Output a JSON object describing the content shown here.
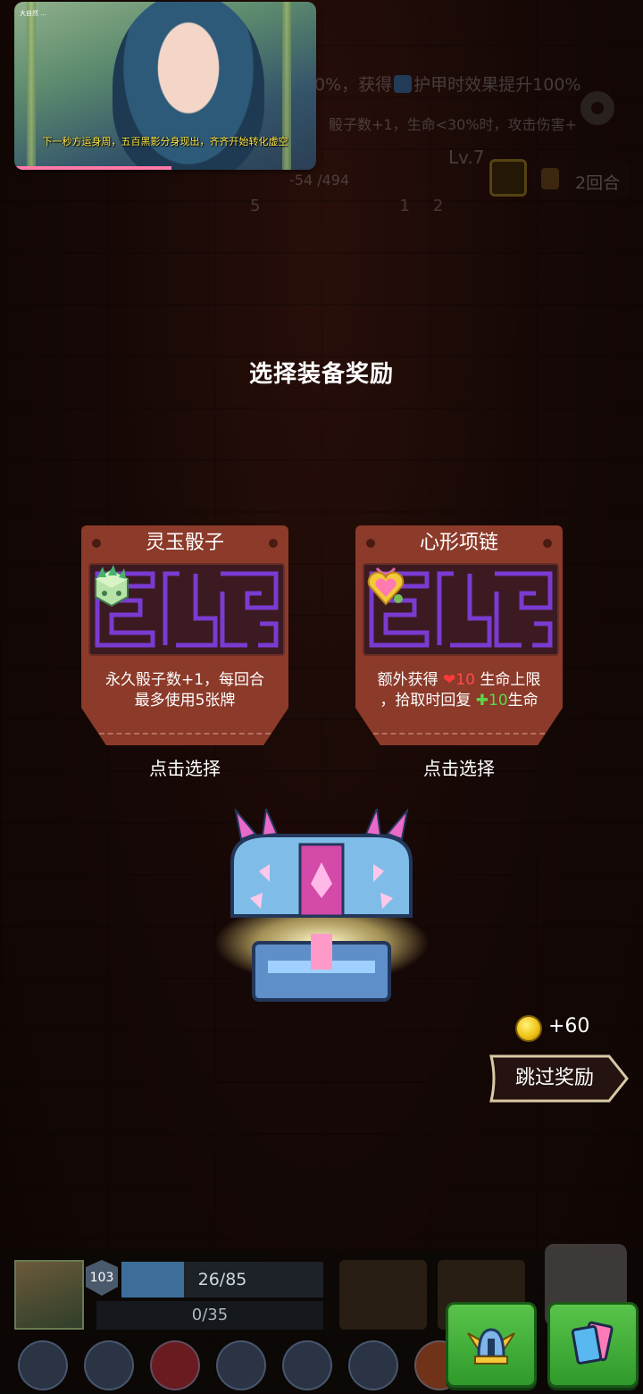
{
  "hud": {
    "buff_line1": "0%，获得",
    "buff_line1_b": "护甲时效果提升100%",
    "buff_line2": "骰子数+1，生命<30%时，攻击伤害+",
    "level": "Lv.7",
    "hp": "-54 /494",
    "round": "2回合",
    "stat_a": "5",
    "stat_b": "1",
    "stat_c": "2"
  },
  "notification": {
    "tiny_text": "大自然 ...",
    "caption": "下一秒方运身周，五百黑影分身现出，齐齐开始转化虚空",
    "progress": 0.52
  },
  "title": "选择装备奖励",
  "cards": [
    {
      "name": "灵玉骰子",
      "desc_line1": "永久骰子数+1，每回合",
      "desc_line2": "最多使用5张牌",
      "pick": "点击选择",
      "icon": "jade-dice-icon"
    },
    {
      "name": "心形项链",
      "desc_pre": "额外获得",
      "desc_hp_max": "10",
      "desc_mid": "生命上限",
      "desc_line2_pre": "，拾取时回复",
      "desc_heal": "10",
      "desc_heal_suffix": "生命",
      "pick": "点击选择",
      "icon": "heart-necklace-icon"
    }
  ],
  "reward": {
    "coins": "+60",
    "skip_label": "跳过奖励"
  },
  "player": {
    "level": "103",
    "hp_text": "26/85",
    "hp_fraction": 0.31,
    "shield_text": "0/35"
  },
  "colors": {
    "card_brown": "#8c3a2a",
    "maze_purple": "#7a3bd0",
    "accent_green": "#2f9a2b",
    "coin_gold": "#f0c418"
  }
}
